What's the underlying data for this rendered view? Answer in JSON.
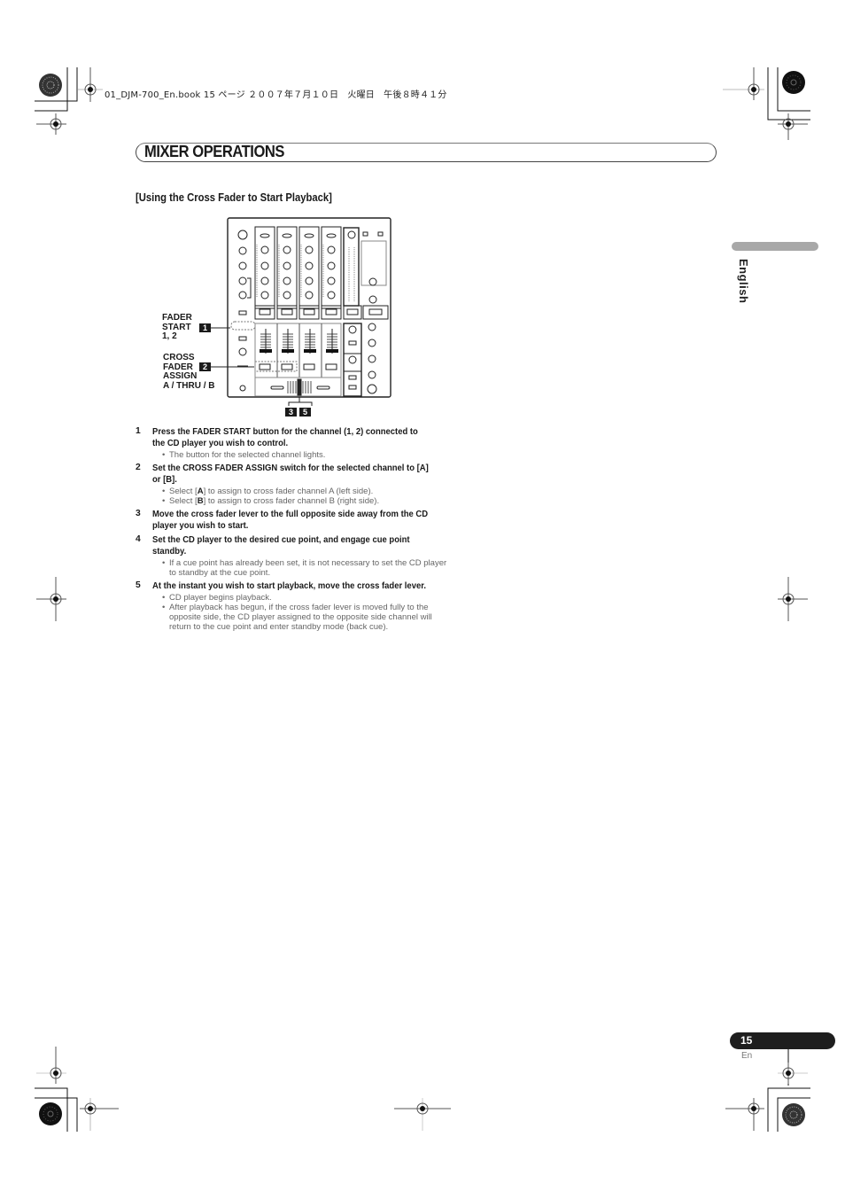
{
  "file_header": "01_DJM-700_En.book  15 ページ  ２００７年７月１０日　火曜日　午後８時４１分",
  "page": {
    "chapter_title": "MIXER OPERATIONS",
    "section_heading": "[Using the Cross Fader to Start Playback]",
    "language_tab": "English",
    "page_number": "15",
    "page_lang": "En"
  },
  "figure": {
    "labels": {
      "fader_start": [
        "FADER",
        "START",
        "1, 2"
      ],
      "cross_fader_assign": [
        "CROSS",
        "FADER",
        "ASSIGN",
        "A / THRU / B"
      ]
    },
    "callouts": [
      "1",
      "2",
      "3",
      "5"
    ]
  },
  "steps": [
    {
      "num": "1",
      "text": "Press the FADER START button for the channel (1, 2) connected to the CD player you wish to control.",
      "bullets": [
        "The button for the selected channel lights."
      ]
    },
    {
      "num": "2",
      "text": "Set the CROSS FADER ASSIGN switch for the selected channel to [A] or [B].",
      "bullets": [
        {
          "pre": "Select [",
          "key": "A",
          "post": "] to assign to cross fader channel A (left side)."
        },
        {
          "pre": "Select [",
          "key": "B",
          "post": "] to assign to cross fader channel B (right side)."
        }
      ]
    },
    {
      "num": "3",
      "text": "Move the cross fader lever to the full opposite side away from the CD player you wish to start.",
      "bullets": []
    },
    {
      "num": "4",
      "text": "Set the CD player to the desired cue point, and engage cue point standby.",
      "bullets": [
        "If a cue point has already been set, it is not necessary to set the CD player to standby at the cue point."
      ]
    },
    {
      "num": "5",
      "text": "At the instant you wish to start playback, move the cross fader lever.",
      "bullets": [
        "CD player begins playback.",
        "After playback has begun, if the cross fader lever is moved fully to the opposite side, the CD player assigned to the opposite side channel will return to the cue point and enter standby mode (back cue)."
      ]
    }
  ]
}
